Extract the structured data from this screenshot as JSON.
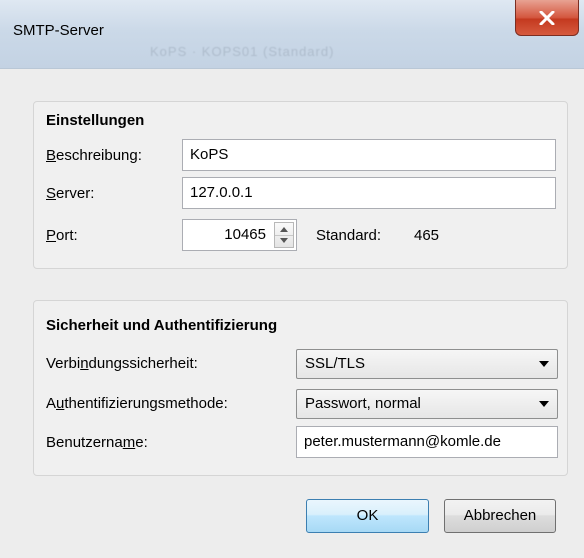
{
  "window": {
    "title": "SMTP-Server",
    "background_ghost_text": "KoPS · KOPS01 (Standard)"
  },
  "settings": {
    "group_title": "Einstellungen",
    "description": {
      "label_pre": "",
      "label_u": "B",
      "label_post": "eschreibung:",
      "value": "KoPS"
    },
    "server": {
      "label_pre": "",
      "label_u": "S",
      "label_post": "erver:",
      "value": "127.0.0.1"
    },
    "port": {
      "label_pre": "",
      "label_u": "P",
      "label_post": "ort:",
      "value": "10465",
      "default_label": "Standard:",
      "default_value": "465"
    }
  },
  "security": {
    "group_title": "Sicherheit und Authentifizierung",
    "connection": {
      "label_pre": "Verbi",
      "label_u": "n",
      "label_post": "dungssicherheit:",
      "value": "SSL/TLS"
    },
    "auth_method": {
      "label_pre": "A",
      "label_u": "u",
      "label_post": "thentifizierungsmethode:",
      "value": "Passwort, normal"
    },
    "username": {
      "label_pre": "Benutzerna",
      "label_u": "m",
      "label_post": "e:",
      "value": "peter.mustermann@komle.de"
    }
  },
  "buttons": {
    "ok": "OK",
    "cancel": "Abbrechen"
  },
  "colors": {
    "close_button": "#c43a20",
    "default_button_border": "#3c7fb1"
  },
  "icons": {
    "close": "close-icon",
    "spin_up": "arrow-up-icon",
    "spin_down": "arrow-down-icon",
    "dropdown": "chevron-down-icon"
  }
}
